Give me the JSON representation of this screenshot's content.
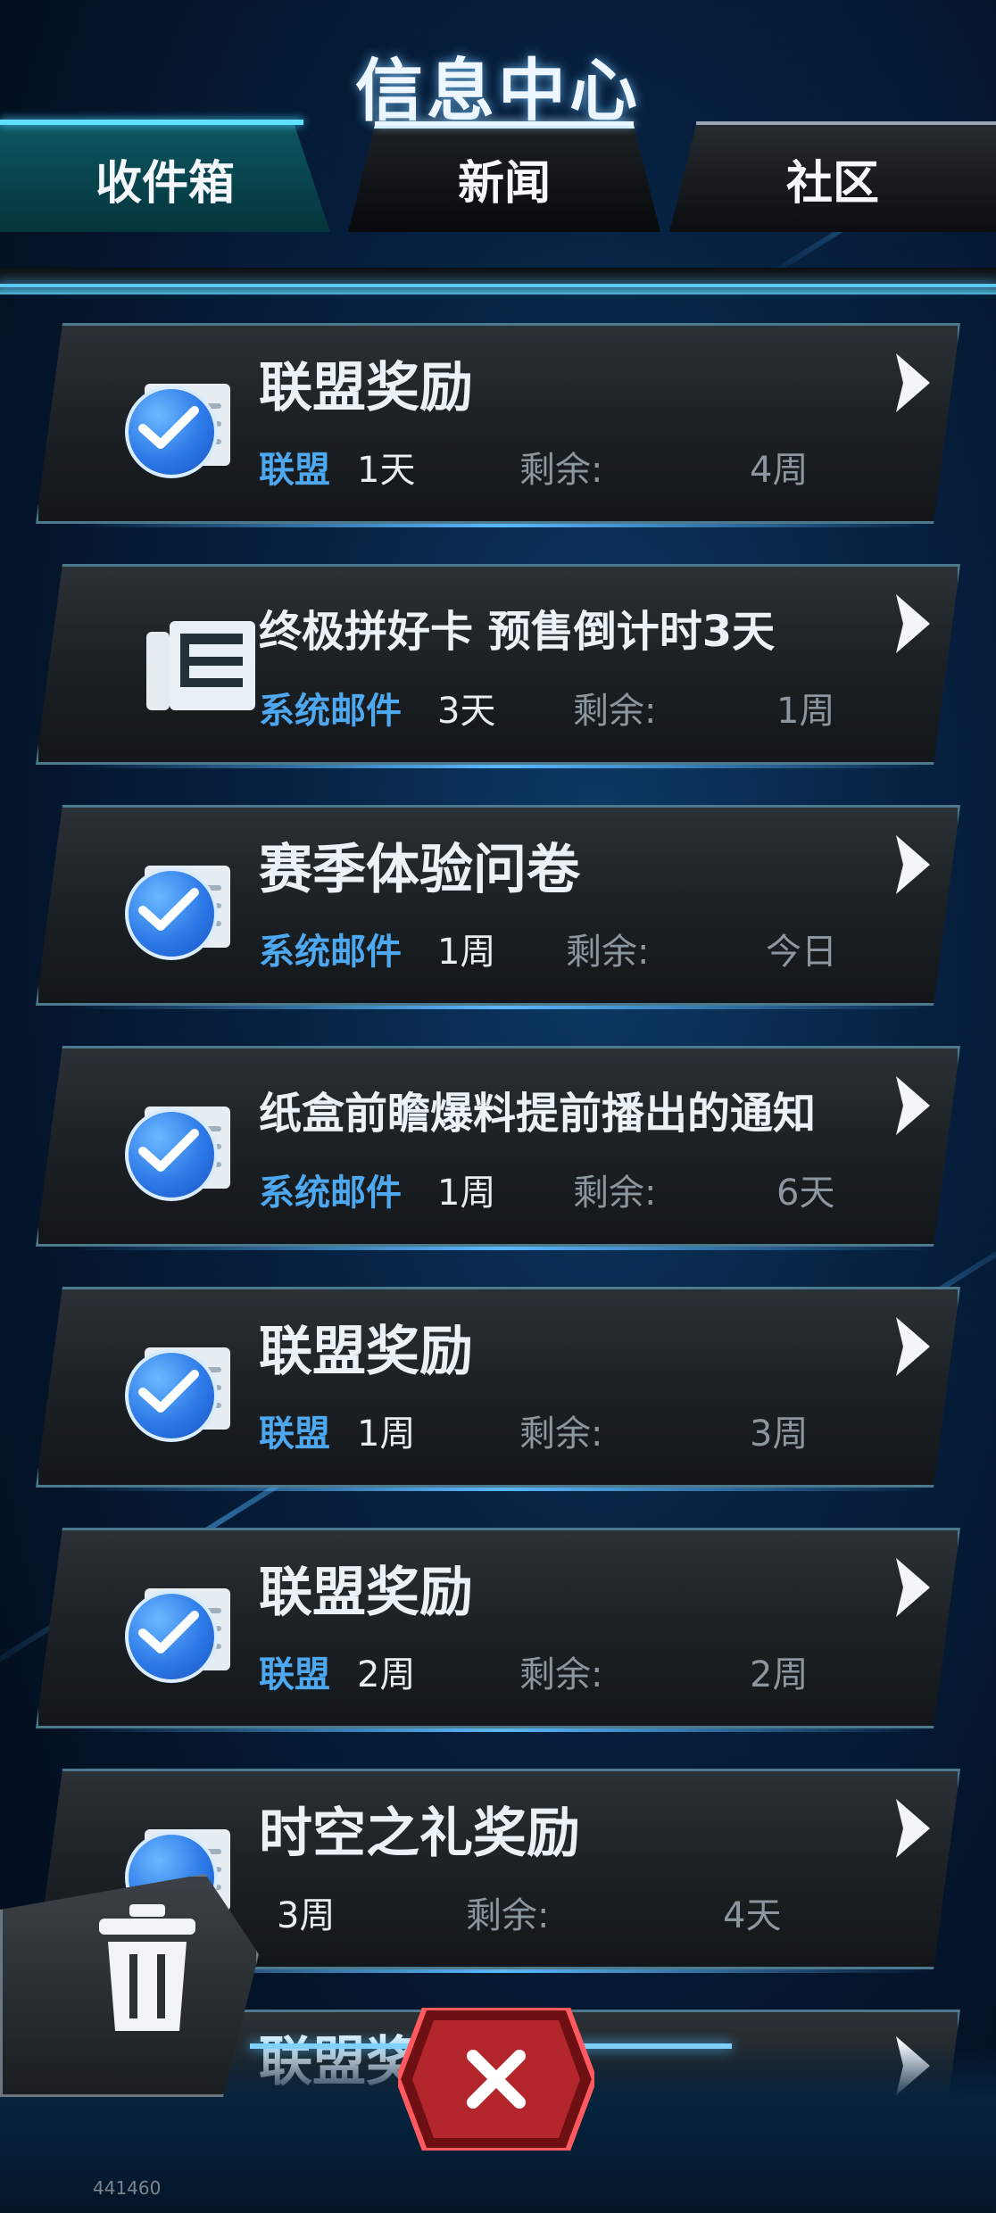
{
  "header": {
    "title": "信息中心"
  },
  "tabs": [
    {
      "label": "收件箱",
      "active": false
    },
    {
      "label": "新闻",
      "active": true
    },
    {
      "label": "社区",
      "active": false
    }
  ],
  "mail_list": [
    {
      "icon": "check-icon",
      "title": "联盟奖励",
      "sender": "联盟",
      "age": "1天",
      "remaining_label": "剩余:",
      "remaining": "4周"
    },
    {
      "icon": "news-icon",
      "title": "终极拼好卡 预售倒计时3天",
      "sender": "系统邮件",
      "age": "3天",
      "remaining_label": "剩余:",
      "remaining": "1周"
    },
    {
      "icon": "check-icon",
      "title": "赛季体验问卷",
      "sender": "系统邮件",
      "age": "1周",
      "remaining_label": "剩余:",
      "remaining": "今日"
    },
    {
      "icon": "check-icon",
      "title": "纸盒前瞻爆料提前播出的通知",
      "sender": "系统邮件",
      "age": "1周",
      "remaining_label": "剩余:",
      "remaining": "6天"
    },
    {
      "icon": "check-icon",
      "title": "联盟奖励",
      "sender": "联盟",
      "age": "1周",
      "remaining_label": "剩余:",
      "remaining": "3周"
    },
    {
      "icon": "check-icon",
      "title": "联盟奖励",
      "sender": "联盟",
      "age": "2周",
      "remaining_label": "剩余:",
      "remaining": "2周"
    },
    {
      "icon": "check-icon",
      "title": "时空之礼奖励",
      "sender": "",
      "age": "3周",
      "remaining_label": "剩余:",
      "remaining": "4天"
    },
    {
      "icon": "check-icon",
      "title": "联盟奖",
      "sender": "",
      "age": "",
      "remaining_label": "",
      "remaining": ""
    }
  ],
  "controls": {
    "delete_icon": "trash-icon",
    "close_icon": "close-icon",
    "accent_color": "#4ea8f0",
    "close_color": "#b3262b"
  },
  "footer": {
    "id": "441460"
  }
}
